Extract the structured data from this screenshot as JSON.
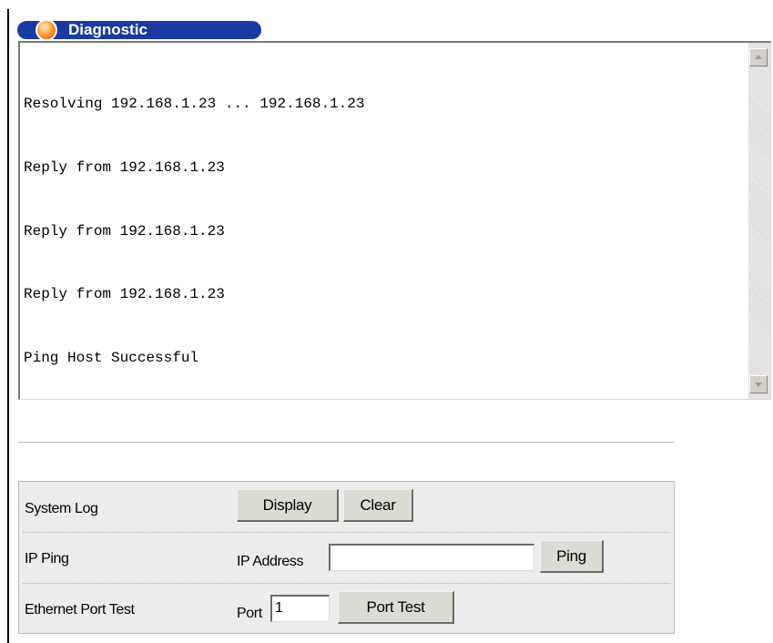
{
  "window": {
    "title": "Diagnostic"
  },
  "output": {
    "lines": [
      "Resolving 192.168.1.23 ... 192.168.1.23",
      "Reply from 192.168.1.23",
      "Reply from 192.168.1.23",
      "Reply from 192.168.1.23",
      "Ping Host Successful"
    ]
  },
  "controls": {
    "system_log": {
      "label": "System Log",
      "display_button": "Display",
      "clear_button": "Clear"
    },
    "ip_ping": {
      "label": "IP Ping",
      "address_label": "IP Address",
      "address_value": "",
      "ping_button": "Ping"
    },
    "port_test": {
      "label": "Ethernet Port Test",
      "port_label": "Port",
      "port_value": "1",
      "port_test_button": "Port Test"
    }
  },
  "icons": {
    "title_orb": "orange-orb-icon",
    "scroll_up": "scroll-up-arrow-icon",
    "scroll_down": "scroll-down-arrow-icon"
  }
}
